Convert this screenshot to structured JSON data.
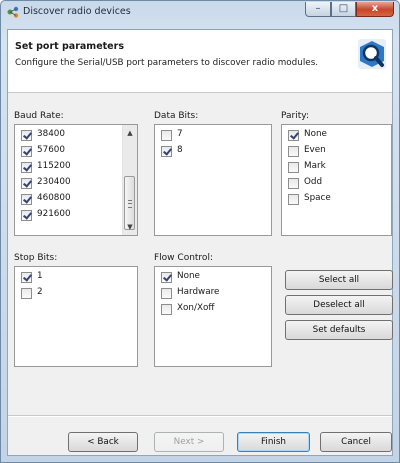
{
  "window": {
    "title": "Discover radio devices",
    "minimize": "–",
    "maximize": "□",
    "close": "x"
  },
  "header": {
    "title": "Set port parameters",
    "subtitle": "Configure the Serial/USB port parameters to discover radio modules."
  },
  "baud_rate": {
    "label": "Baud Rate:",
    "items": [
      {
        "label": "38400",
        "checked": true
      },
      {
        "label": "57600",
        "checked": true
      },
      {
        "label": "115200",
        "checked": true
      },
      {
        "label": "230400",
        "checked": true
      },
      {
        "label": "460800",
        "checked": true
      },
      {
        "label": "921600",
        "checked": true
      }
    ]
  },
  "data_bits": {
    "label": "Data Bits:",
    "items": [
      {
        "label": "7",
        "checked": false
      },
      {
        "label": "8",
        "checked": true
      }
    ]
  },
  "parity": {
    "label": "Parity:",
    "items": [
      {
        "label": "None",
        "checked": true
      },
      {
        "label": "Even",
        "checked": false
      },
      {
        "label": "Mark",
        "checked": false
      },
      {
        "label": "Odd",
        "checked": false
      },
      {
        "label": "Space",
        "checked": false
      }
    ]
  },
  "stop_bits": {
    "label": "Stop Bits:",
    "items": [
      {
        "label": "1",
        "checked": true
      },
      {
        "label": "2",
        "checked": false
      }
    ]
  },
  "flow_control": {
    "label": "Flow Control:",
    "items": [
      {
        "label": "None",
        "checked": true
      },
      {
        "label": "Hardware",
        "checked": false
      },
      {
        "label": "Xon/Xoff",
        "checked": false
      }
    ]
  },
  "actions": {
    "select_all": "Select all",
    "deselect_all": "Deselect all",
    "set_defaults": "Set defaults"
  },
  "footer": {
    "back": "< Back",
    "next": "Next >",
    "finish": "Finish",
    "cancel": "Cancel"
  }
}
